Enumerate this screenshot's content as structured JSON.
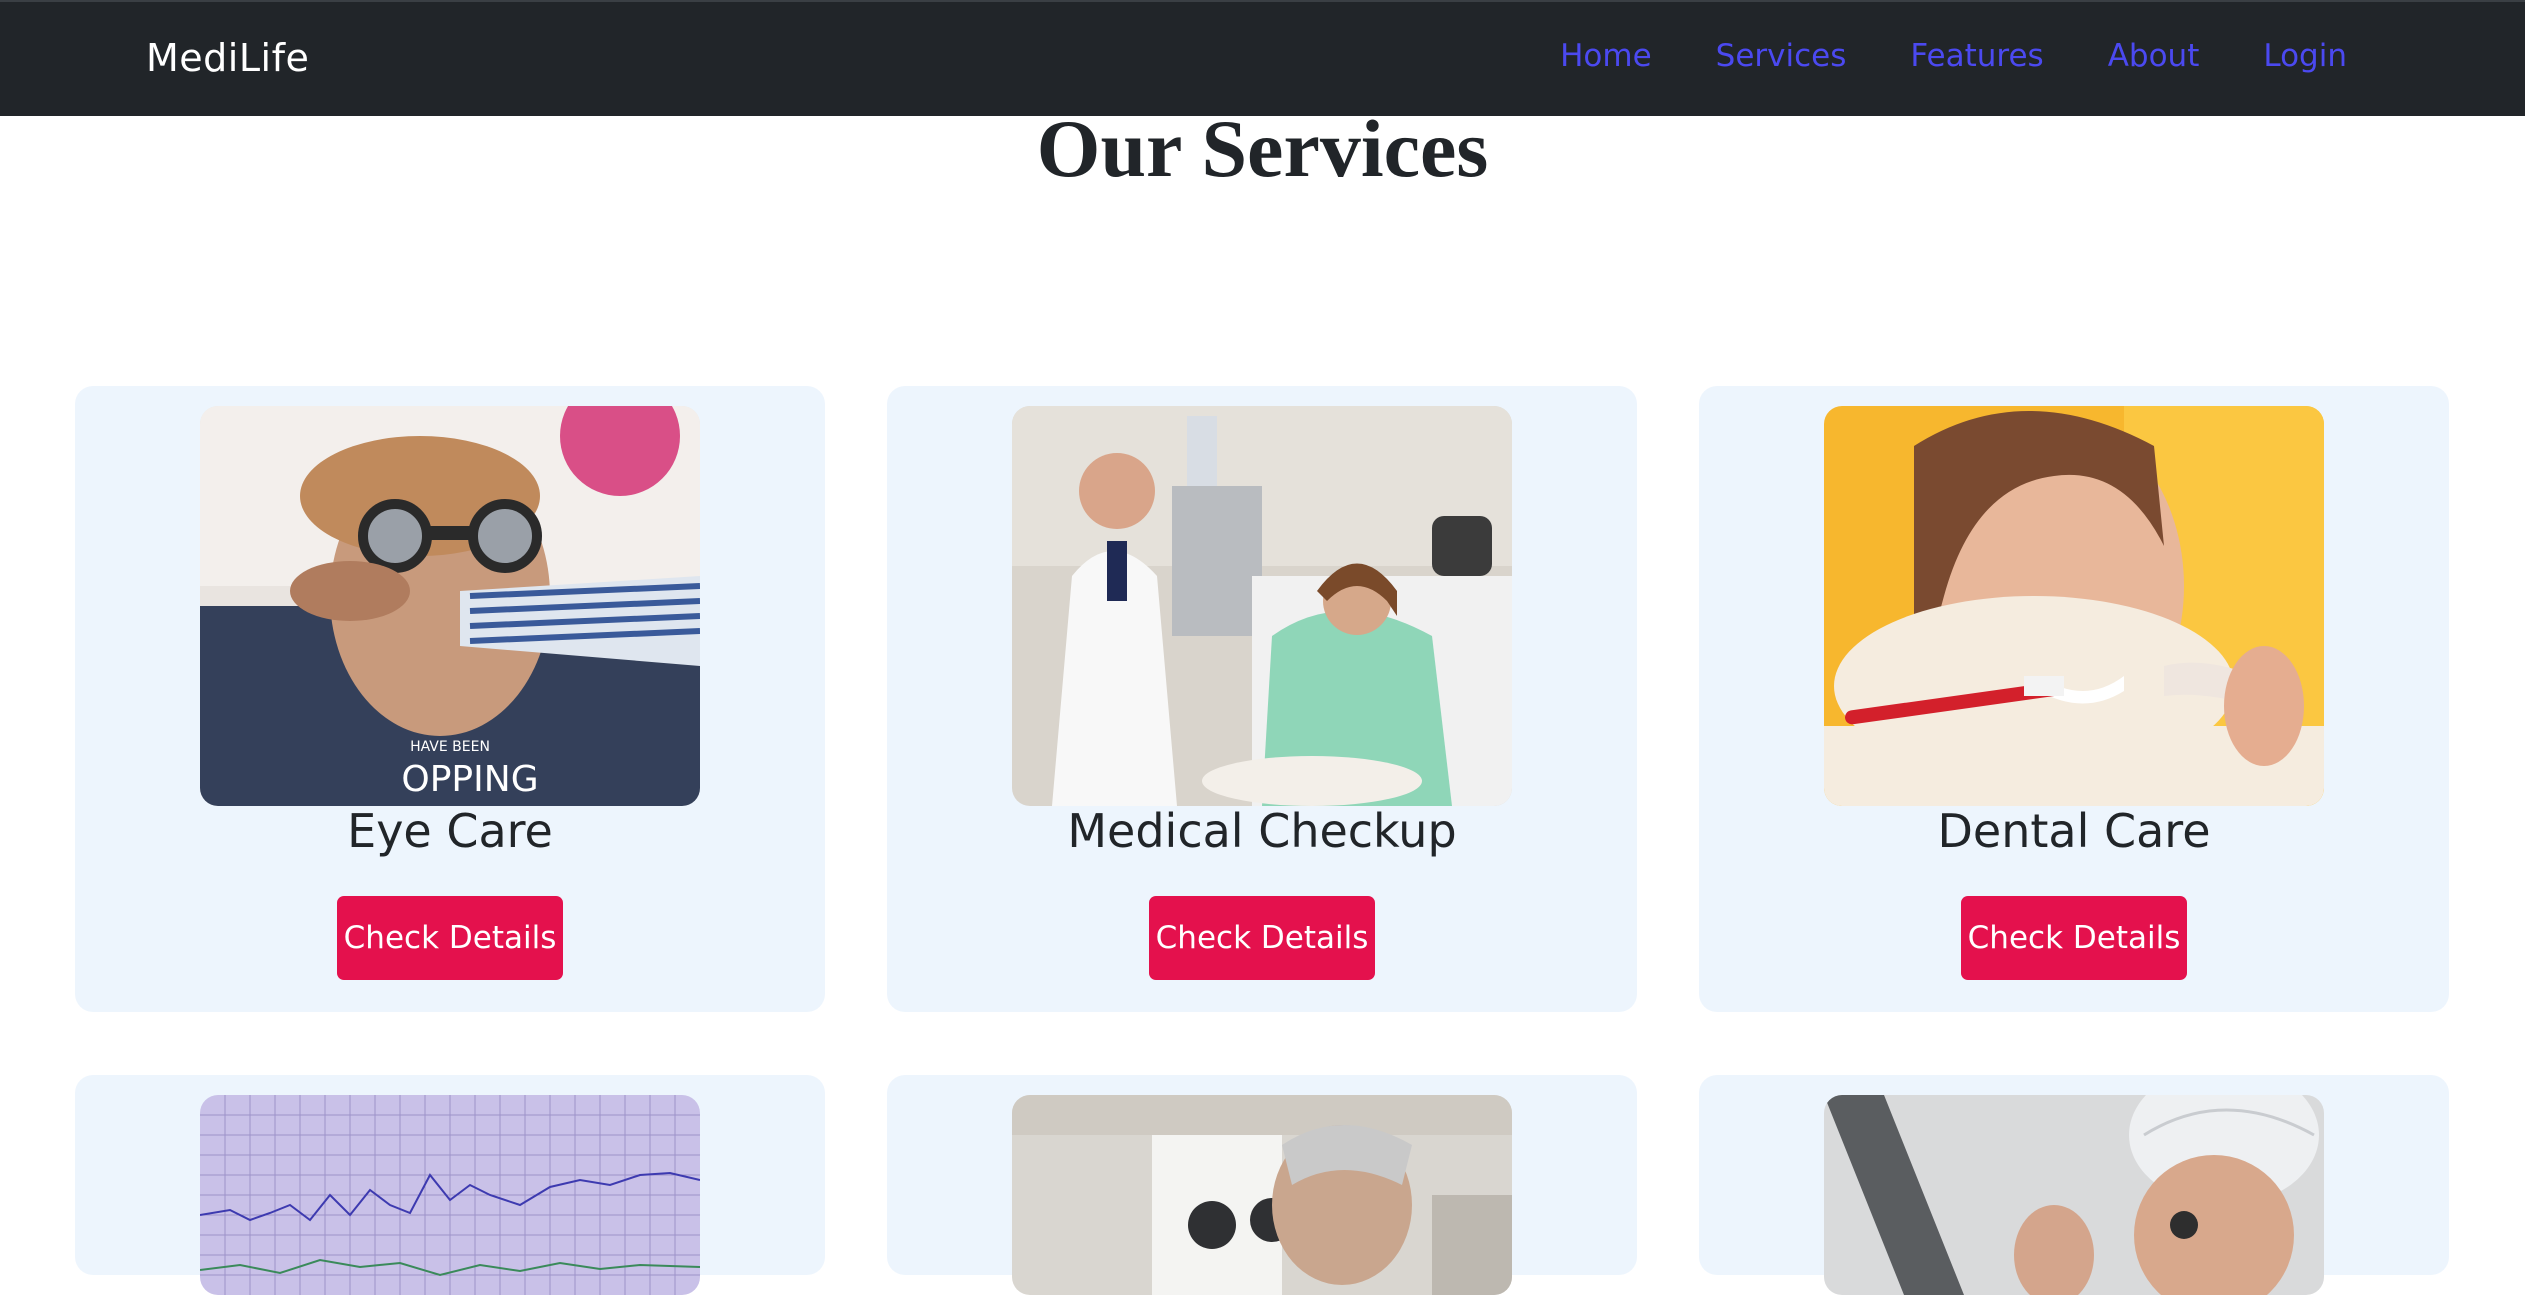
{
  "navbar": {
    "brand": "MediLife",
    "links": [
      {
        "label": "Home"
      },
      {
        "label": "Services"
      },
      {
        "label": "Features"
      },
      {
        "label": "About"
      },
      {
        "label": "Login"
      }
    ]
  },
  "main": {
    "title": "Our Services",
    "cards": [
      {
        "title": "Eye Care",
        "button": "Check Details",
        "image": "eye-exam-photo"
      },
      {
        "title": "Medical Checkup",
        "button": "Check Details",
        "image": "doctor-patient-photo"
      },
      {
        "title": "Dental Care",
        "button": "Check Details",
        "image": "toothbrush-photo"
      },
      {
        "title": "",
        "button": "",
        "image": "ecg-chart-photo"
      },
      {
        "title": "",
        "button": "",
        "image": "lab-microscope-photo"
      },
      {
        "title": "",
        "button": "",
        "image": "surgeon-photo"
      }
    ]
  },
  "colors": {
    "navbar_bg": "#212529",
    "nav_link": "#4b49f0",
    "card_bg": "#edf5fd",
    "button_bg": "#e4114d"
  }
}
